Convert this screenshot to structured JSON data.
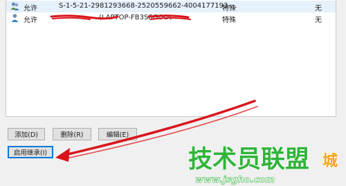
{
  "permission_entries": [
    {
      "type": "允许",
      "principal": "S-1-5-21-2981293668-2520559662-4004177193-...",
      "access": "特殊",
      "inherited_from": "无",
      "icon": "user-group-icon"
    },
    {
      "type": "允许",
      "principal": "(LAPTOP-FB3S8GOO\\",
      "access": "特殊",
      "inherited_from": "无",
      "icon": "user-icon"
    }
  ],
  "buttons": {
    "add_label": "添加(D)",
    "remove_label": "删除(R)",
    "edit_label": "编辑(E)",
    "enable_inheritance_label": "启用继承(I)"
  },
  "watermark": {
    "brand": "技术员联盟",
    "url": "www.jsgho.com",
    "suffix": "城"
  },
  "colors": {
    "annotation_red": "#d9141c",
    "watermark_green": "#2fb43a",
    "selection": "#e5f1fb",
    "focus_border": "#0078d7"
  }
}
